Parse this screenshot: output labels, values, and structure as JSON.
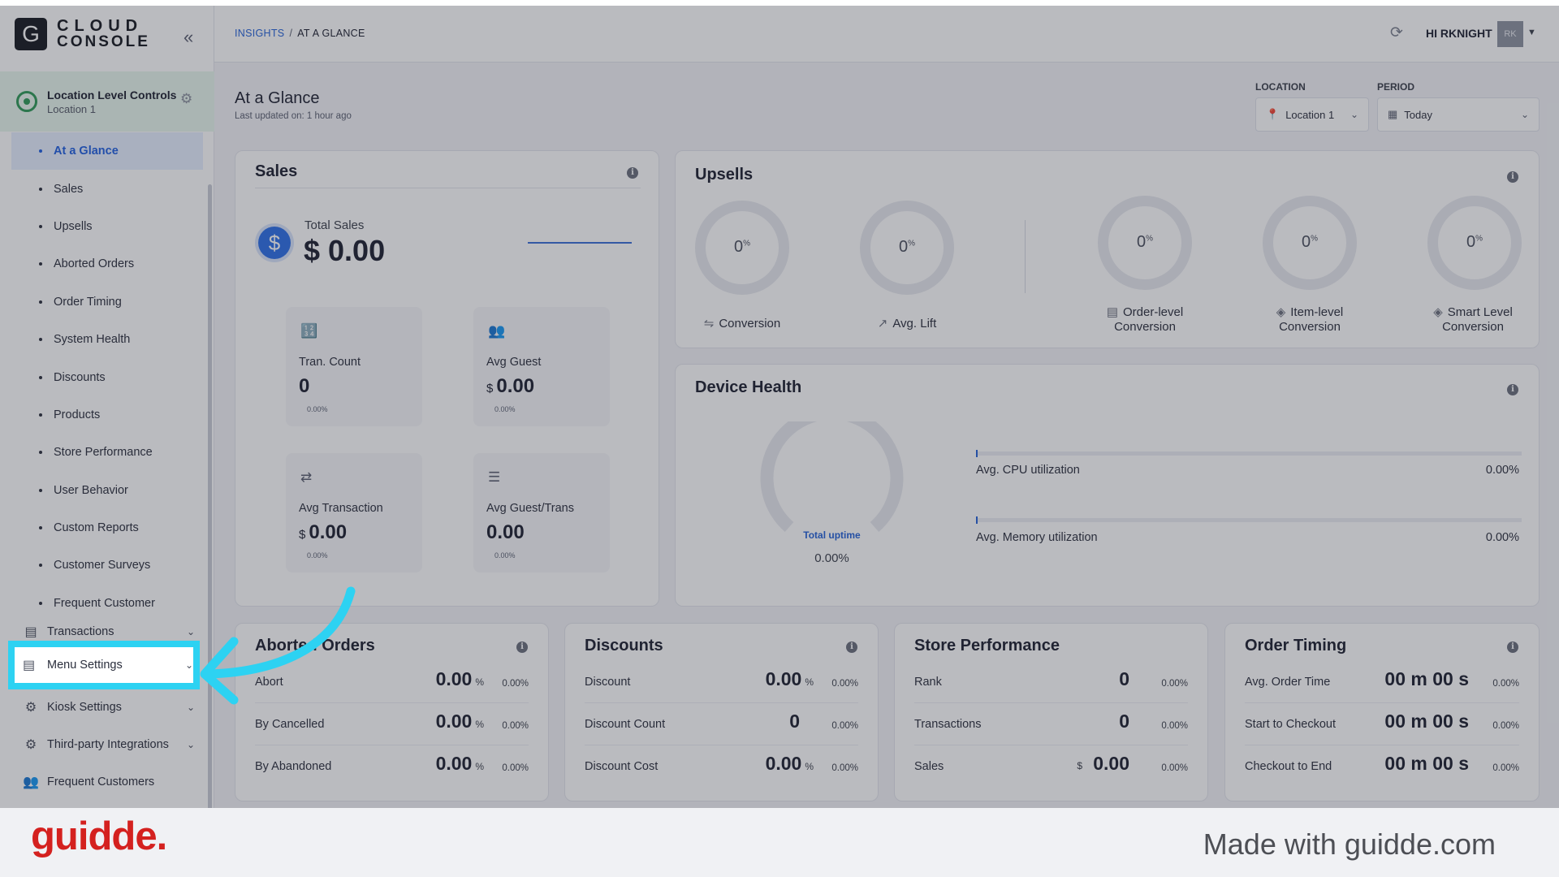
{
  "app": {
    "logo_letter": "G",
    "logo_line1": "CLOUD",
    "logo_line2": "CONSOLE"
  },
  "location_controls": {
    "title": "Location Level Controls",
    "subtitle": "Location 1"
  },
  "sidebar": {
    "insights_items": [
      {
        "label": "At a Glance",
        "active": true
      },
      {
        "label": "Sales"
      },
      {
        "label": "Upsells"
      },
      {
        "label": "Aborted Orders"
      },
      {
        "label": "Order Timing"
      },
      {
        "label": "System Health"
      },
      {
        "label": "Discounts"
      },
      {
        "label": "Products"
      },
      {
        "label": "Store Performance"
      },
      {
        "label": "User Behavior"
      },
      {
        "label": "Custom Reports"
      },
      {
        "label": "Customer Surveys"
      },
      {
        "label": "Frequent Customer"
      }
    ],
    "groups": [
      {
        "label": "Transactions",
        "icon": "receipt-icon"
      },
      {
        "label": "Menu Settings",
        "icon": "menu-card-icon",
        "highlighted": true
      },
      {
        "label": "Kiosk Settings",
        "icon": "gear-icon"
      },
      {
        "label": "Third-party Integrations",
        "icon": "gear-icon"
      },
      {
        "label": "Frequent Customers",
        "icon": "users-icon"
      }
    ]
  },
  "topbar": {
    "breadcrumb_root": "INSIGHTS",
    "breadcrumb_sep": "/",
    "breadcrumb_current": "AT A GLANCE",
    "greeting": "HI RKNIGHT",
    "avatar_initials": "RK"
  },
  "page": {
    "title": "At a Glance",
    "updated": "Last updated on: 1 hour ago"
  },
  "filters": {
    "location_label": "LOCATION",
    "location_value": "Location 1",
    "period_label": "PERIOD",
    "period_value": "Today"
  },
  "sales": {
    "title": "Sales",
    "total_label": "Total Sales",
    "total_value": "$ 0.00",
    "tiles": [
      {
        "label": "Tran. Count",
        "currency": "",
        "value": "0",
        "pct": "0.00%",
        "icon": "123-icon"
      },
      {
        "label": "Avg Guest",
        "currency": "$",
        "value": "0.00",
        "pct": "0.00%",
        "icon": "guests-icon"
      },
      {
        "label": "Avg Transaction",
        "currency": "$",
        "value": "0.00",
        "pct": "0.00%",
        "icon": "transfer-icon"
      },
      {
        "label": "Avg Guest/Trans",
        "currency": "",
        "value": "0.00",
        "pct": "0.00%",
        "icon": "guest-list-icon"
      }
    ]
  },
  "upsells": {
    "title": "Upsells",
    "rings": [
      {
        "value": "0",
        "unit": "%",
        "label1": "Conversion",
        "label2": "",
        "icon": "conversion-icon"
      },
      {
        "value": "0",
        "unit": "%",
        "label1": "Avg. Lift",
        "label2": "",
        "icon": "lift-icon"
      },
      {
        "value": "0",
        "unit": "%",
        "label1": "Order-level",
        "label2": "Conversion",
        "icon": "receipt-icon"
      },
      {
        "value": "0",
        "unit": "%",
        "label1": "Item-level",
        "label2": "Conversion",
        "icon": "box-icon"
      },
      {
        "value": "0",
        "unit": "%",
        "label1": "Smart Level",
        "label2": "Conversion",
        "icon": "box-icon"
      }
    ]
  },
  "device_health": {
    "title": "Device Health",
    "uptime_label": "Total uptime",
    "uptime_value": "0.00%",
    "cpu_label": "Avg. CPU utilization",
    "cpu_value": "0.00%",
    "memory_label": "Avg. Memory utilization",
    "memory_value": "0.00%"
  },
  "aborted_orders": {
    "title": "Aborted Orders",
    "rows": [
      {
        "label": "Abort",
        "value": "0.00",
        "unit": "%",
        "pct": "0.00%"
      },
      {
        "label": "By Cancelled",
        "value": "0.00",
        "unit": "%",
        "pct": "0.00%"
      },
      {
        "label": "By Abandoned",
        "value": "0.00",
        "unit": "%",
        "pct": "0.00%"
      }
    ]
  },
  "discounts": {
    "title": "Discounts",
    "rows": [
      {
        "label": "Discount",
        "value": "0.00",
        "unit": "%",
        "pct": "0.00%"
      },
      {
        "label": "Discount Count",
        "value": "0",
        "unit": "",
        "pct": "0.00%"
      },
      {
        "label": "Discount Cost",
        "value": "0.00",
        "unit": "%",
        "pct": "0.00%"
      }
    ]
  },
  "store_performance": {
    "title": "Store Performance",
    "rows": [
      {
        "label": "Rank",
        "value": "0",
        "currency": "",
        "pct": "0.00%"
      },
      {
        "label": "Transactions",
        "value": "0",
        "currency": "",
        "pct": "0.00%"
      },
      {
        "label": "Sales",
        "value": "0.00",
        "currency": "$",
        "pct": "0.00%"
      }
    ]
  },
  "order_timing": {
    "title": "Order Timing",
    "rows": [
      {
        "label": "Avg. Order Time",
        "value": "00 m 00 s",
        "pct": "0.00%"
      },
      {
        "label": "Start to Checkout",
        "value": "00 m 00 s",
        "pct": "0.00%"
      },
      {
        "label": "Checkout to End",
        "value": "00 m 00 s",
        "pct": "0.00%"
      }
    ]
  },
  "footer": {
    "brand": "guidde.",
    "made_with": "Made with guidde.com"
  },
  "colors": {
    "accent": "#2462d8",
    "highlight": "#2dd2f2",
    "brand": "#d4211f"
  }
}
